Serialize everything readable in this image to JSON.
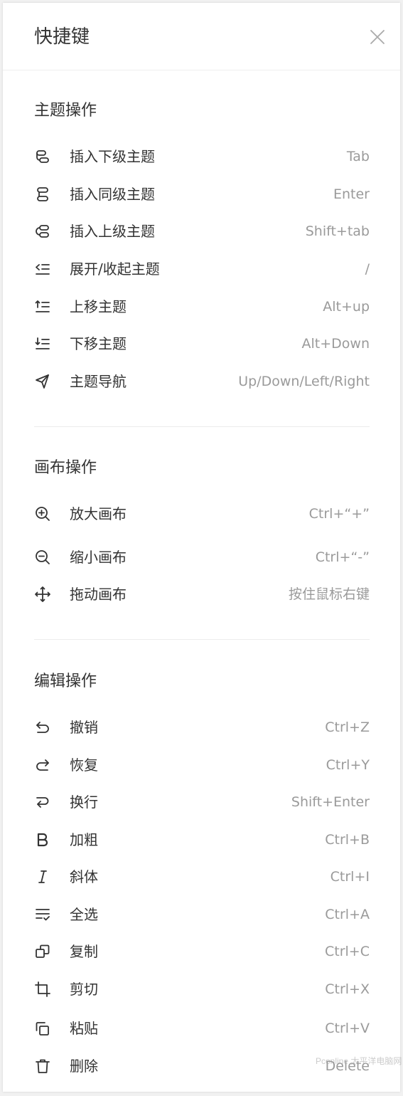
{
  "header": {
    "title": "快捷键"
  },
  "sections": [
    {
      "title": "主题操作",
      "items": [
        {
          "label": "插入下级主题",
          "key": "Tab",
          "icon": "insert-child-icon"
        },
        {
          "label": "插入同级主题",
          "key": "Enter",
          "icon": "insert-sibling-icon"
        },
        {
          "label": "插入上级主题",
          "key": "Shift+tab",
          "icon": "insert-parent-icon"
        },
        {
          "label": "展开/收起主题",
          "key": "/",
          "icon": "expand-collapse-icon"
        },
        {
          "label": "上移主题",
          "key": "Alt+up",
          "icon": "move-up-icon"
        },
        {
          "label": "下移主题",
          "key": "Alt+Down",
          "icon": "move-down-icon"
        },
        {
          "label": "主题导航",
          "key": "Up/Down/Left/Right",
          "icon": "navigate-icon"
        }
      ]
    },
    {
      "title": "画布操作",
      "items": [
        {
          "label": "放大画布",
          "key": "Ctrl+“+”",
          "icon": "zoom-in-icon"
        },
        {
          "label": "缩小画布",
          "key": "Ctrl+“-”",
          "icon": "zoom-out-icon"
        },
        {
          "label": "拖动画布",
          "key": "按住鼠标右键",
          "icon": "move-canvas-icon"
        }
      ]
    },
    {
      "title": "编辑操作",
      "items": [
        {
          "label": "撤销",
          "key": "Ctrl+Z",
          "icon": "undo-icon"
        },
        {
          "label": "恢复",
          "key": "Ctrl+Y",
          "icon": "redo-icon"
        },
        {
          "label": "换行",
          "key": "Shift+Enter",
          "icon": "line-break-icon"
        },
        {
          "label": "加粗",
          "key": "Ctrl+B",
          "icon": "bold-icon"
        },
        {
          "label": "斜体",
          "key": "Ctrl+I",
          "icon": "italic-icon"
        },
        {
          "label": "全选",
          "key": "Ctrl+A",
          "icon": "select-all-icon"
        },
        {
          "label": "复制",
          "key": "Ctrl+C",
          "icon": "copy-icon"
        },
        {
          "label": "剪切",
          "key": "Ctrl+X",
          "icon": "crop-cut-icon"
        },
        {
          "label": "粘贴",
          "key": "Ctrl+V",
          "icon": "paste-icon"
        },
        {
          "label": "删除",
          "key": "Delete",
          "icon": "delete-icon"
        }
      ]
    }
  ],
  "watermark": "Pconline 太平洋电脑网"
}
